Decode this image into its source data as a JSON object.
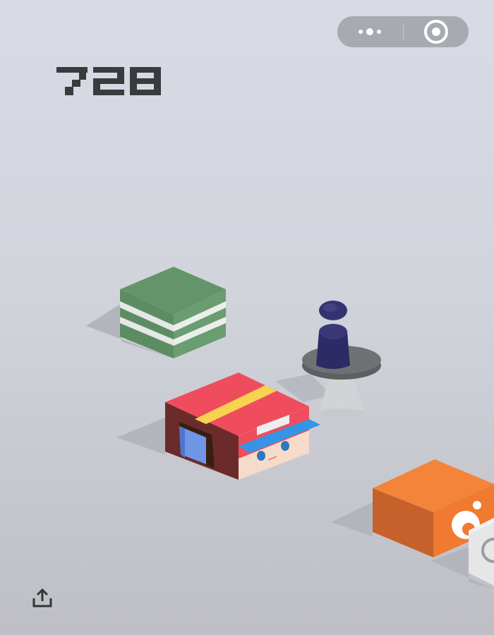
{
  "game": {
    "score": "728"
  },
  "top_bar": {
    "more_icon": "ellipsis-icon",
    "close_icon": "target-ring-icon"
  },
  "bottom_bar": {
    "share_icon": "share-upload-icon"
  },
  "scene": {
    "platforms": [
      {
        "name": "green-striped-cube",
        "color": "#63966a",
        "stripe": "#e7e9e7"
      },
      {
        "name": "gray-pedestal",
        "color": "#6f7073"
      },
      {
        "name": "orange-cube",
        "color": "#f07f33"
      },
      {
        "name": "white-box",
        "color": "#e6e6e6"
      }
    ],
    "player": {
      "name": "red-cap-character",
      "cap_color": "#ef4c5d",
      "stripe_color": "#f7d34f",
      "visor_color": "#3596e6",
      "face_color": "#f6dccb",
      "pawn_color": "#2c2a63"
    }
  }
}
